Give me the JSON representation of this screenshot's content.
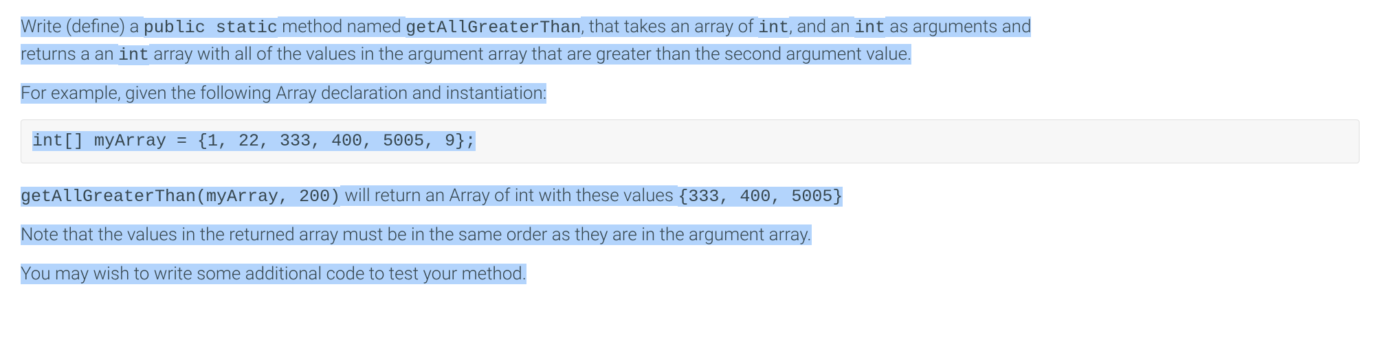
{
  "paragraphs": {
    "p1": {
      "text1": "Write (define) a ",
      "code1": "public static",
      "text2": " method named ",
      "code2": "getAllGreaterThan",
      "text3": ", that takes an array of ",
      "code3": "int",
      "text4": ", and an ",
      "code4": "int",
      "text5": " as arguments and",
      "text6": "returns a an ",
      "code5": "int",
      "text7": " array with all of the values in the argument array that are greater than the second argument value."
    },
    "p2": {
      "text1": "For example, given the following Array declaration and instantiation:"
    },
    "codeblock": {
      "content": "int[] myArray = {1, 22, 333, 400, 5005, 9};"
    },
    "p3": {
      "code1": "getAllGreaterThan(myArray, 200)",
      "text1": " will return an Array of int with these values ",
      "code2": "{333, 400, 5005}"
    },
    "p4": {
      "text1": "Note that the values in the returned array must be in the same order as they are in the argument array."
    },
    "p5": {
      "text1": "You may wish to write some additional code to test your method."
    }
  }
}
